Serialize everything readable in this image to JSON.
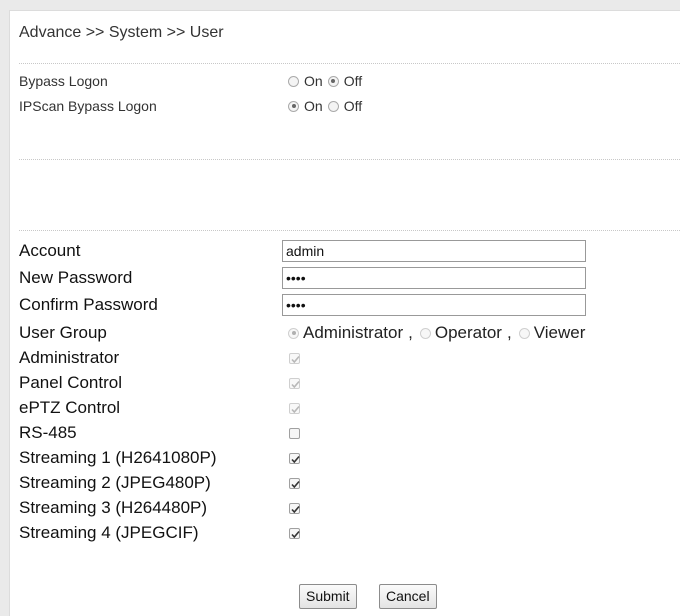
{
  "breadcrumb": "Advance >> System >> User",
  "bypass": {
    "bypass_logon": {
      "label": "Bypass Logon",
      "on_label": "On",
      "off_label": "Off",
      "selected": "Off"
    },
    "ipscan_bypass_logon": {
      "label": "IPScan Bypass Logon",
      "on_label": "On",
      "off_label": "Off",
      "selected": "On"
    }
  },
  "account": {
    "account_label": "Account",
    "account_value": "admin",
    "new_password_label": "New Password",
    "new_password_mask": "••••",
    "confirm_password_label": "Confirm Password",
    "confirm_password_mask": "••••",
    "user_group_label": "User Group",
    "user_group_options": [
      "Administrator",
      "Operator",
      "Viewer"
    ],
    "user_group_sep": ",",
    "user_group_selected": "Administrator"
  },
  "permissions": [
    {
      "label": "Administrator",
      "checked": true,
      "disabled": true
    },
    {
      "label": "Panel Control",
      "checked": true,
      "disabled": true
    },
    {
      "label": "ePTZ Control",
      "checked": true,
      "disabled": true
    },
    {
      "label": "RS-485",
      "checked": false,
      "disabled": false
    },
    {
      "label": "Streaming 1 (H2641080P)",
      "checked": true,
      "disabled": false
    },
    {
      "label": "Streaming 2 (JPEG480P)",
      "checked": true,
      "disabled": false
    },
    {
      "label": "Streaming 3 (H264480P)",
      "checked": true,
      "disabled": false
    },
    {
      "label": "Streaming 4 (JPEGCIF)",
      "checked": true,
      "disabled": false
    }
  ],
  "buttons": {
    "submit": "Submit",
    "cancel": "Cancel"
  }
}
